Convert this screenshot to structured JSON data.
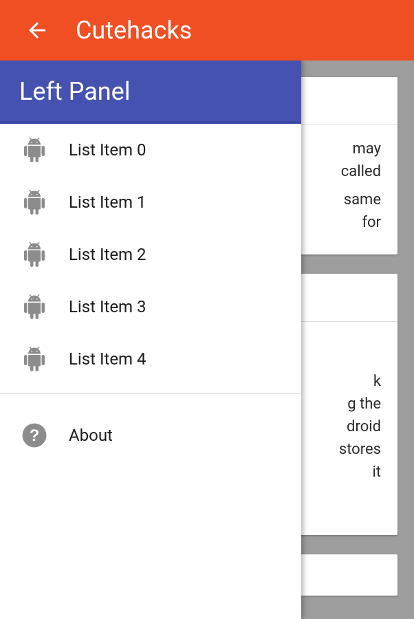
{
  "appbar": {
    "title": "Cutehacks"
  },
  "drawer": {
    "header": "Left Panel",
    "items": [
      {
        "label": "List Item 0"
      },
      {
        "label": "List Item 1"
      },
      {
        "label": "List Item 2"
      },
      {
        "label": "List Item 3"
      },
      {
        "label": "List Item 4"
      }
    ],
    "about_label": "About"
  },
  "background_cards": {
    "card1_lines": [
      "may",
      "called",
      "same",
      "for"
    ],
    "card2_lines": [
      "k",
      "g the",
      "droid",
      "stores",
      "it"
    ]
  }
}
